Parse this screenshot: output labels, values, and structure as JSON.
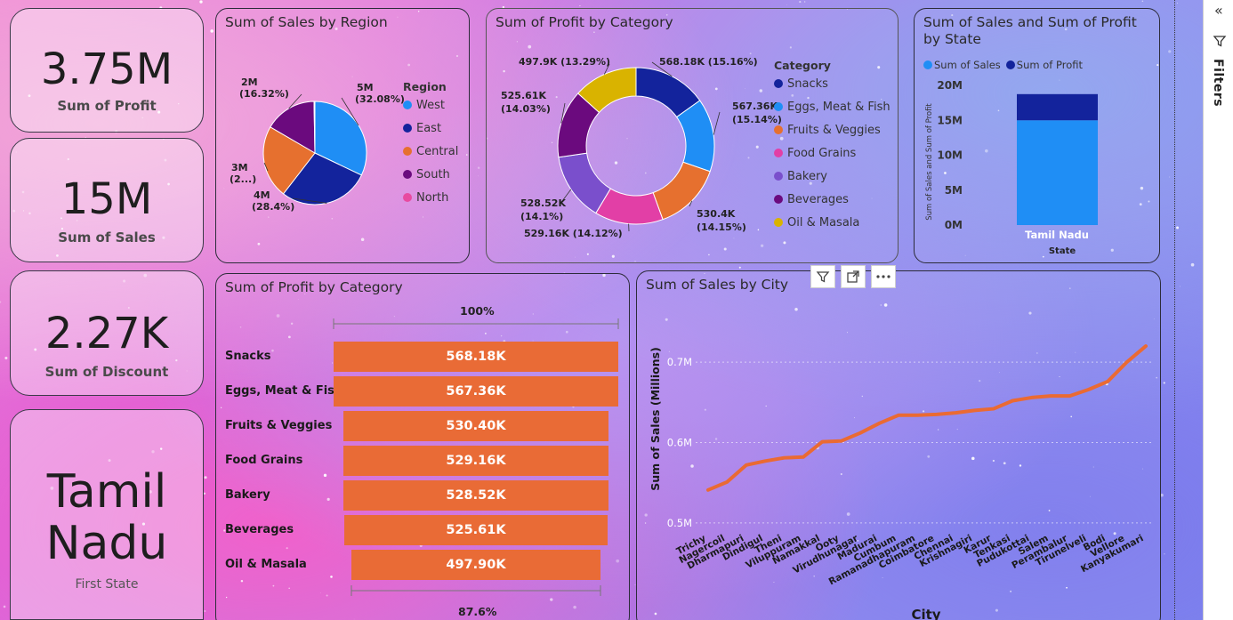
{
  "kpis": [
    {
      "value": "3.75M",
      "label": "Sum of Profit"
    },
    {
      "value": "15M",
      "label": "Sum of Sales"
    },
    {
      "value": "2.27K",
      "label": "Sum of Discount"
    },
    {
      "value_line1": "Tamil",
      "value_line2": "Nadu",
      "label": "First State"
    }
  ],
  "region_pie": {
    "title": "Sum of Sales by Region",
    "legend_title": "Region",
    "slices": [
      {
        "name": "West",
        "label_value": "5M",
        "label_pct": "(32.08%)",
        "pct": 32.08,
        "color": "#1f8ef5"
      },
      {
        "name": "East",
        "label_value": "4M",
        "label_pct": "(28.4%)",
        "pct": 28.4,
        "color": "#13239c"
      },
      {
        "name": "Central",
        "label_value": "3M",
        "label_pct": "(2...)",
        "pct": 22.92,
        "color": "#e6702f"
      },
      {
        "name": "South",
        "label_value": "2M",
        "label_pct": "(16.32%)",
        "pct": 16.32,
        "color": "#6b0a7e"
      },
      {
        "name": "North",
        "label_value": "",
        "label_pct": "",
        "pct": 0.28,
        "color": "#e84aa0"
      }
    ]
  },
  "category_donut": {
    "title": "Sum of Profit by Category",
    "legend_title": "Category",
    "slices": [
      {
        "name": "Snacks",
        "label": "568.18K (15.16%)",
        "pct": 15.16,
        "color": "#13239c"
      },
      {
        "name": "Eggs, Meat & Fish",
        "label_line1": "567.36K",
        "label_line2": "(15.14%)",
        "pct": 15.14,
        "color": "#1f8ef5"
      },
      {
        "name": "Fruits & Veggies",
        "label_line1": "530.4K",
        "label_line2": "(14.15%)",
        "pct": 14.15,
        "color": "#e6702f"
      },
      {
        "name": "Food Grains",
        "label": "529.16K (14.12%)",
        "pct": 14.12,
        "color": "#e23fa6"
      },
      {
        "name": "Bakery",
        "label_line1": "528.52K",
        "label_line2": "(14.1%)",
        "pct": 14.1,
        "color": "#7a4fcc"
      },
      {
        "name": "Beverages",
        "label_line1": "525.61K",
        "label_line2": "(14.03%)",
        "pct": 14.03,
        "color": "#6b0a7e"
      },
      {
        "name": "Oil & Masala",
        "label": "497.9K (13.29%)",
        "pct": 13.29,
        "color": "#d9b300"
      }
    ]
  },
  "state_chart": {
    "title_line1": "Sum of Sales and Sum of Profit",
    "title_line2": "by State",
    "legend": [
      {
        "name": "Sum of Sales",
        "color": "#1f8ef5"
      },
      {
        "name": "Sum of Profit",
        "color": "#13239c"
      }
    ],
    "y_axis_label": "Sum of Sales and Sum of Profit",
    "x_axis_label": "State",
    "y_ticks": [
      "20M",
      "15M",
      "10M",
      "5M",
      "0M"
    ],
    "category": "Tamil Nadu"
  },
  "funnel": {
    "title": "Sum of Profit by Category",
    "top_pct": "100%",
    "bottom_pct": "87.6%",
    "rows": [
      {
        "category": "Snacks",
        "value_label": "568.18K"
      },
      {
        "category": "Eggs, Meat & Fish",
        "value_label": "567.36K"
      },
      {
        "category": "Fruits & Veggies",
        "value_label": "530.40K"
      },
      {
        "category": "Food Grains",
        "value_label": "529.16K"
      },
      {
        "category": "Bakery",
        "value_label": "528.52K"
      },
      {
        "category": "Beverages",
        "value_label": "525.61K"
      },
      {
        "category": "Oil & Masala",
        "value_label": "497.90K"
      }
    ]
  },
  "city_chart": {
    "title": "Sum of Sales by City",
    "y_axis_label": "Sum of Sales (Millions)",
    "x_axis_label": "City",
    "y_ticks": [
      "0.7M",
      "0.6M",
      "0.5M"
    ],
    "cities": [
      "Trichy",
      "Nagercoil",
      "Dharmapuri",
      "Dindigul",
      "Theni",
      "Viluppuram",
      "Namakkal",
      "Ooty",
      "Virudhunagar",
      "Madurai",
      "Cumbum",
      "Ramanadhapuram",
      "Coimbatore",
      "Chennai",
      "Krishnagiri",
      "Karur",
      "Tenkasi",
      "Pudukottai",
      "Salem",
      "Perambalur",
      "Tirunelveli",
      "Bodi",
      "Vellore",
      "Kanyakumari"
    ]
  },
  "chart_data": [
    {
      "type": "pie",
      "title": "Sum of Sales by Region",
      "categories": [
        "West",
        "East",
        "Central",
        "South",
        "North"
      ],
      "values": [
        32.08,
        28.4,
        22.92,
        16.32,
        0.28
      ]
    },
    {
      "type": "pie",
      "title": "Sum of Profit by Category",
      "categories": [
        "Snacks",
        "Eggs, Meat & Fish",
        "Fruits & Veggies",
        "Food Grains",
        "Bakery",
        "Beverages",
        "Oil & Masala"
      ],
      "values": [
        568.18,
        567.36,
        530.4,
        529.16,
        528.52,
        525.61,
        497.9
      ]
    },
    {
      "type": "bar",
      "title": "Sum of Sales and Sum of Profit by State",
      "categories": [
        "Tamil Nadu"
      ],
      "series": [
        {
          "name": "Sum of Sales",
          "values": [
            15
          ]
        },
        {
          "name": "Sum of Profit",
          "values": [
            3.75
          ]
        }
      ],
      "ylim": [
        0,
        20
      ]
    },
    {
      "type": "bar",
      "title": "Sum of Profit by Category",
      "categories": [
        "Snacks",
        "Eggs, Meat & Fish",
        "Fruits & Veggies",
        "Food Grains",
        "Bakery",
        "Beverages",
        "Oil & Masala"
      ],
      "values": [
        568.18,
        567.36,
        530.4,
        529.16,
        528.52,
        525.61,
        497.9
      ]
    },
    {
      "type": "line",
      "title": "Sum of Sales by City",
      "xlabel": "City",
      "ylabel": "Sum of Sales (Millions)",
      "x": [
        "Trichy",
        "Nagercoil",
        "Dharmapuri",
        "Dindigul",
        "Theni",
        "Viluppuram",
        "Namakkal",
        "Ooty",
        "Virudhunagar",
        "Madurai",
        "Cumbum",
        "Ramanadhapuram",
        "Coimbatore",
        "Chennai",
        "Krishnagiri",
        "Karur",
        "Tenkasi",
        "Pudukottai",
        "Salem",
        "Perambalur",
        "Tirunelveli",
        "Bodi",
        "Vellore",
        "Kanyakumari"
      ],
      "values": [
        0.541,
        0.551,
        0.572,
        0.577,
        0.581,
        0.582,
        0.601,
        0.602,
        0.612,
        0.624,
        0.634,
        0.634,
        0.635,
        0.637,
        0.64,
        0.642,
        0.652,
        0.656,
        0.658,
        0.658,
        0.666,
        0.676,
        0.7,
        0.72
      ],
      "ylim": [
        0.47,
        0.74
      ]
    }
  ],
  "filters_pane": {
    "label": "Filters"
  }
}
